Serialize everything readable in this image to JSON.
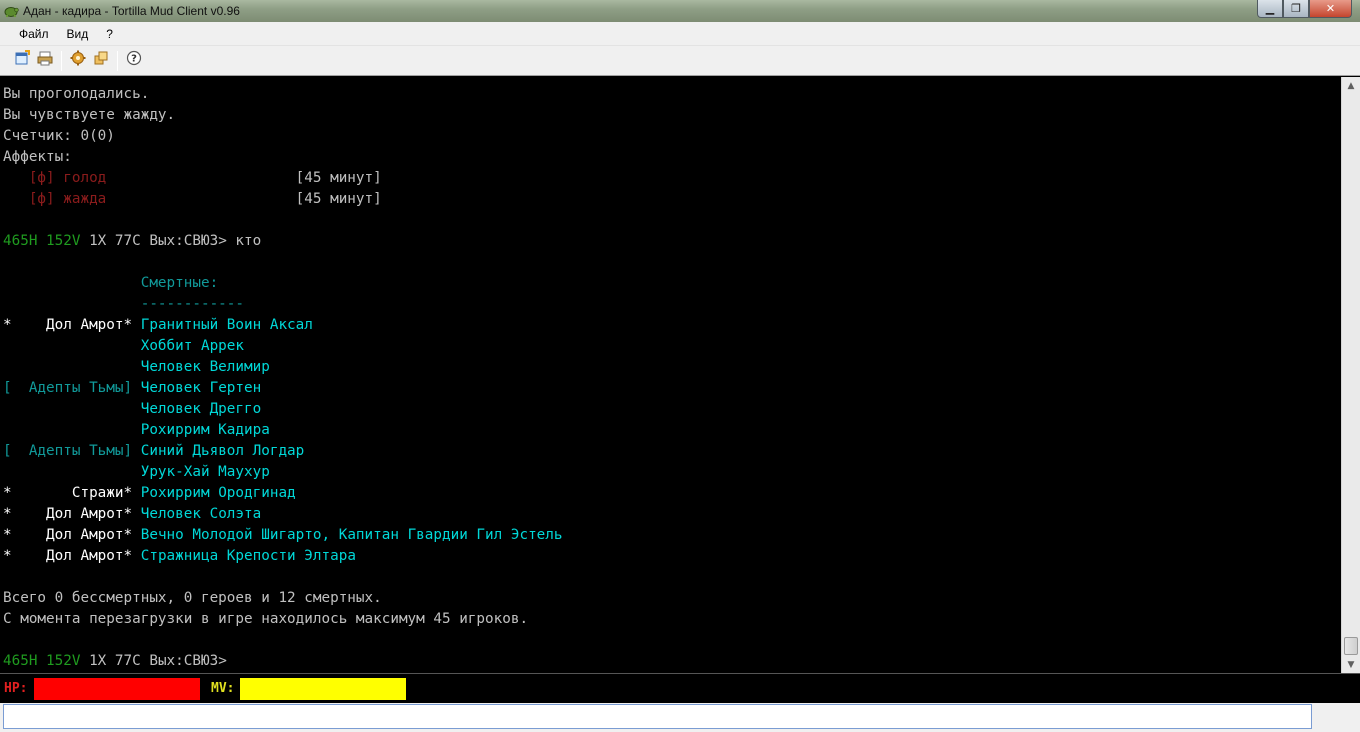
{
  "window": {
    "title": "Адан - кадира - Tortilla Mud Client v0.96",
    "min_glyph": "▁",
    "max_glyph": "❐",
    "close_glyph": "✕"
  },
  "menu": {
    "items": [
      {
        "label": "Файл"
      },
      {
        "label": "Вид"
      },
      {
        "label": "?"
      }
    ]
  },
  "toolbar": {
    "buttons": [
      {
        "icon": "new-window-icon"
      },
      {
        "icon": "print-log-icon"
      },
      {
        "icon": "settings-gear-icon"
      },
      {
        "icon": "plugins-icon"
      },
      {
        "icon": "help-icon"
      }
    ]
  },
  "terminal": {
    "lines": [
      [
        {
          "t": "Вы проголодались.",
          "c": "c-white"
        }
      ],
      [
        {
          "t": "Вы чувствуете жажду.",
          "c": "c-white"
        }
      ],
      [
        {
          "t": "Счетчик: 0(0)",
          "c": "c-white"
        }
      ],
      [
        {
          "t": "Аффекты:",
          "c": "c-white"
        }
      ],
      [
        {
          "t": "   [ф] голод                      ",
          "c": "c-red"
        },
        {
          "t": "[45 минут]",
          "c": "c-white"
        }
      ],
      [
        {
          "t": "   [ф] жажда                      ",
          "c": "c-red"
        },
        {
          "t": "[45 минут]",
          "c": "c-white"
        }
      ],
      [],
      [
        {
          "t": "465H 152V ",
          "c": "c-green"
        },
        {
          "t": "1X 77C Вых:СВЮЗ> кто",
          "c": "c-white"
        }
      ],
      [],
      [
        {
          "t": "                Смертные:",
          "c": "c-teal"
        }
      ],
      [
        {
          "t": "                ------------",
          "c": "c-teal"
        }
      ],
      [
        {
          "t": "*    Дол Амрот* ",
          "c": "c-bwhite"
        },
        {
          "t": "Гранитный Воин Аксал",
          "c": "c-cyan"
        }
      ],
      [
        {
          "t": "                Хоббит Аррек",
          "c": "c-cyan"
        }
      ],
      [
        {
          "t": "                Человек Велимир",
          "c": "c-cyan"
        }
      ],
      [
        {
          "t": "[  Адепты Тьмы] ",
          "c": "c-teal"
        },
        {
          "t": "Человек Гертен",
          "c": "c-cyan"
        }
      ],
      [
        {
          "t": "                Человек Дрегго",
          "c": "c-cyan"
        }
      ],
      [
        {
          "t": "                Рохиррим Кадира",
          "c": "c-cyan"
        }
      ],
      [
        {
          "t": "[  Адепты Тьмы] ",
          "c": "c-teal"
        },
        {
          "t": "Синий Дьявол Логдар",
          "c": "c-cyan"
        }
      ],
      [
        {
          "t": "                Урук-Хай Маухур",
          "c": "c-cyan"
        }
      ],
      [
        {
          "t": "*       Стражи* ",
          "c": "c-bwhite"
        },
        {
          "t": "Рохиррим Ородгинад",
          "c": "c-cyan"
        }
      ],
      [
        {
          "t": "*    Дол Амрот* ",
          "c": "c-bwhite"
        },
        {
          "t": "Человек Солэта",
          "c": "c-cyan"
        }
      ],
      [
        {
          "t": "*    Дол Амрот* ",
          "c": "c-bwhite"
        },
        {
          "t": "Вечно Молодой Шигарто, Капитан Гвардии Гил Эстель",
          "c": "c-cyan"
        }
      ],
      [
        {
          "t": "*    Дол Амрот* ",
          "c": "c-bwhite"
        },
        {
          "t": "Стражница Крепости Элтара",
          "c": "c-cyan"
        }
      ],
      [],
      [
        {
          "t": "Всего 0 бессмертных, 0 героев и 12 смертных.",
          "c": "c-white"
        }
      ],
      [
        {
          "t": "С момента перезагрузки в игре находилось максимум 45 игроков.",
          "c": "c-white"
        }
      ],
      [],
      [
        {
          "t": "465H 152V ",
          "c": "c-green"
        },
        {
          "t": "1X 77C Вых:СВЮЗ>",
          "c": "c-white"
        }
      ]
    ]
  },
  "status": {
    "hp_label": "HP:",
    "hp_fraction": 1.0,
    "hp_color": "#ff0000",
    "mv_label": "MV:",
    "mv_fraction": 1.0,
    "mv_color": "#ffff00"
  },
  "input": {
    "value": ""
  }
}
